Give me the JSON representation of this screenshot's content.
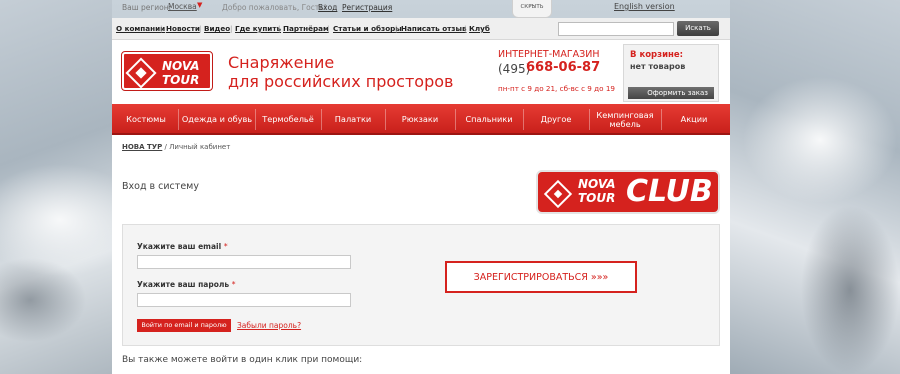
{
  "topline": {
    "region_label": "Ваш регион:",
    "region_value": "Москва",
    "region_arrow": "▼",
    "welcome": "Добро пожаловать, Гость!",
    "login": "Вход",
    "register": "Регистрация",
    "hide_tab": "СКРЫТЬ",
    "hide_arrow": "︿",
    "english": "English version"
  },
  "utilbar": {
    "links": [
      "О компании",
      "Новости",
      "Видео",
      "Где купить",
      "Партнёрам",
      "Статьи и обзоры",
      "Написать отзыв",
      "Клуб"
    ],
    "separator": "|",
    "search_placeholder": "",
    "search_button": "Искать"
  },
  "header": {
    "logo_line1": "NOVA",
    "logo_line2": "TOUR",
    "tagline_line1": "Снаряжение",
    "tagline_line2": "для российских просторов",
    "shop_label": "ИНТЕРНЕТ-МАГАЗИН",
    "phone_code": "(495)",
    "phone_number": "668-06-87",
    "hours": "пн-пт с 9 до 21,  сб-вс с 9 до 19"
  },
  "cart": {
    "title": "В корзине:",
    "status": "нет товаров",
    "checkout": "Оформить заказ"
  },
  "nav": {
    "items": [
      "Костюмы",
      "Одежда и обувь",
      "Термобельё",
      "Палатки",
      "Рюкзаки",
      "Спальники",
      "Другое",
      "Кемпинговая мебель",
      "Акции"
    ]
  },
  "breadcrumb": {
    "home": "НОВА ТУР",
    "separator": " / ",
    "current": "Личный кабинет"
  },
  "page": {
    "title": "Вход в систему",
    "club_nova": "NOVA",
    "club_tour": "TOUR",
    "club_word": "CLUB"
  },
  "login_form": {
    "email_label": "Укажите ваш email",
    "password_label": "Укажите ваш пароль",
    "required_mark": "*",
    "email_value": "",
    "password_value": "",
    "submit": "Войти по email и паролю",
    "forgot": "Забыли пароль?",
    "register": "ЗАРЕГИСТРИРОВАТЬСЯ »»»"
  },
  "oneclick_text": "Вы также можете войти в один клик при помощи:",
  "colors": {
    "brand_red": "#d5221e",
    "dark_button": "#454545",
    "panel_bg": "#f4f4f4"
  }
}
